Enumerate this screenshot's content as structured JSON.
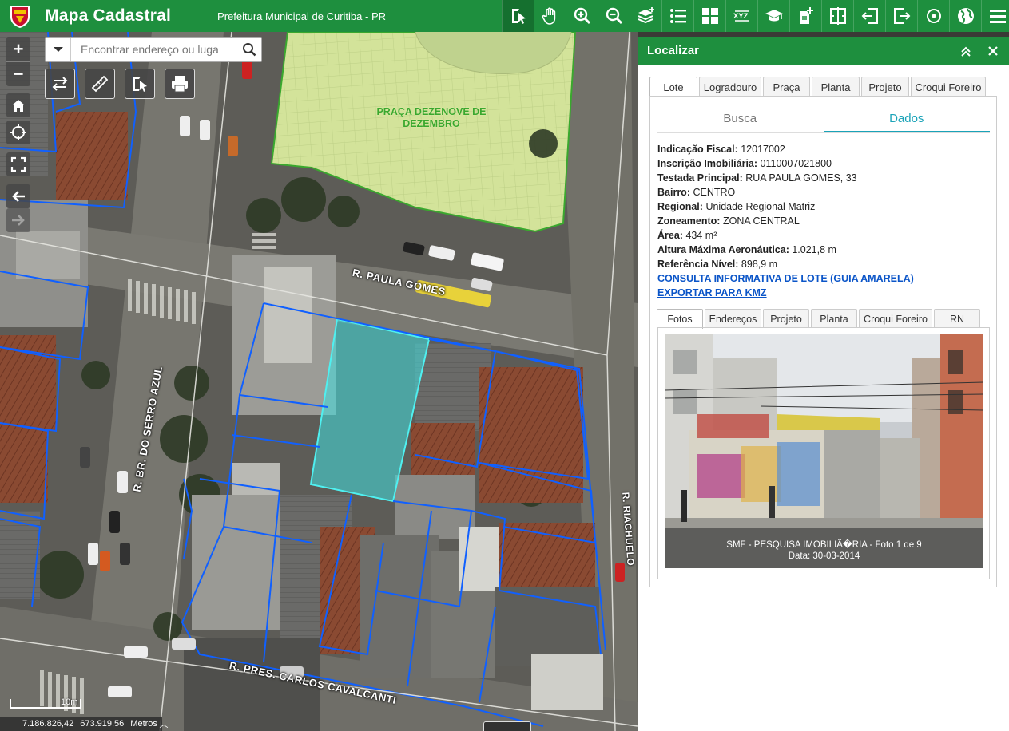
{
  "header": {
    "title": "Mapa Cadastral",
    "organization": "Prefeitura Municipal de Curitiba - PR",
    "toolbar": [
      {
        "icon": "identify-icon",
        "active": true
      },
      {
        "icon": "pan-hand-icon"
      },
      {
        "icon": "zoom-in-icon"
      },
      {
        "icon": "zoom-out-icon"
      },
      {
        "icon": "layers-icon"
      },
      {
        "icon": "legend-list-icon"
      },
      {
        "icon": "grid-icon"
      },
      {
        "icon": "xyz-coordinates-icon"
      },
      {
        "icon": "graduation-cap-icon"
      },
      {
        "icon": "add-document-icon"
      },
      {
        "icon": "compare-panels-icon"
      },
      {
        "icon": "import-icon"
      },
      {
        "icon": "export-icon"
      },
      {
        "icon": "target-icon"
      },
      {
        "icon": "globe-icon"
      },
      {
        "icon": "menu-icon"
      }
    ]
  },
  "map": {
    "search_placeholder": "Encontrar endereço ou luga",
    "zoom_in": "+",
    "zoom_out": "−",
    "streets": {
      "paula_gomes": "R. PAULA GOMES",
      "serro_azul": "R. BR. DO SERRO AZUL",
      "riachuelo": "R. RIACHUELO",
      "carlos_cavalcanti": "R. PRES. CARLOS CAVALCANTI"
    },
    "praca_label": "PRAÇA DEZENOVE DE DEZEMBRO",
    "scale_label": "10m",
    "coordinates": {
      "x": "7.186.826,42",
      "y": "673.919,56",
      "unit": "Metros"
    }
  },
  "panel": {
    "title": "Localizar",
    "tabs": [
      "Lote",
      "Logradouro",
      "Praça",
      "Planta",
      "Projeto",
      "Croqui Foreiro"
    ],
    "active_tab": "Lote",
    "subtabs": [
      "Busca",
      "Dados"
    ],
    "active_subtab": "Dados",
    "fields": [
      {
        "label": "Indicação Fiscal:",
        "value": "12017002"
      },
      {
        "label": "Inscrição Imobiliária:",
        "value": "0110007021800"
      },
      {
        "label": "Testada Principal:",
        "value": "RUA PAULA GOMES, 33"
      },
      {
        "label": "Bairro:",
        "value": "CENTRO"
      },
      {
        "label": "Regional:",
        "value": "Unidade Regional Matriz"
      },
      {
        "label": "Zoneamento:",
        "value": "ZONA CENTRAL"
      },
      {
        "label": "Área:",
        "value": "434 m²"
      },
      {
        "label": "Altura Máxima Aeronáutica:",
        "value": "1.021,8 m"
      },
      {
        "label": "Referência Nível:",
        "value": "898,9 m"
      }
    ],
    "links": {
      "consulta": "CONSULTA INFORMATIVA DE LOTE (GUIA AMARELA)",
      "exportar": "EXPORTAR PARA KMZ"
    },
    "photo_tabs": [
      "Fotos",
      "Endereços",
      "Projeto",
      "Planta",
      "Croqui Foreiro",
      "RN"
    ],
    "active_photo_tab": "Fotos",
    "photo_caption_line1": "SMF - PESQUISA IMOBILIÃ�RIA - Foto 1 de 9",
    "photo_caption_line2": "Data: 30-03-2014"
  },
  "colors": {
    "header": "#1e8f3e",
    "accent": "#1aa3b8",
    "parcel_outline": "#1060ff",
    "selected_parcel": "#3fe0e0",
    "plaza": "#c9df8a"
  }
}
